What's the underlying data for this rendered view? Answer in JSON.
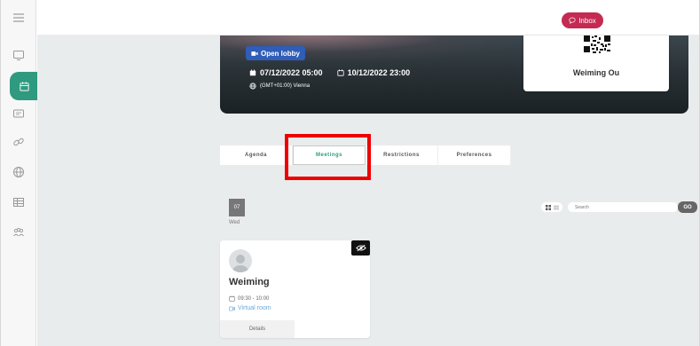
{
  "sidebar": {
    "items": [
      {
        "icon": "menu-icon"
      },
      {
        "icon": "monitor-icon"
      },
      {
        "icon": "calendar-icon",
        "active": true
      },
      {
        "icon": "contact-card-icon"
      },
      {
        "icon": "link-icon"
      },
      {
        "icon": "globe-icon"
      },
      {
        "icon": "table-icon"
      },
      {
        "icon": "group-icon"
      }
    ],
    "accent": "#2f9a7f"
  },
  "header": {
    "inbox_label": "Inbox",
    "inbox_color": "#c42a52"
  },
  "event": {
    "open_lobby_label": "Open lobby",
    "start": "07/12/2022 05:00",
    "end": "10/12/2022 23:00",
    "timezone": "(GMT+01:00) Vienna"
  },
  "user": {
    "name": "Weiming Ou"
  },
  "tabs": [
    {
      "label": "Agenda"
    },
    {
      "label": "Meetings",
      "active": true
    },
    {
      "label": "Restrictions"
    },
    {
      "label": "Preferences"
    }
  ],
  "day": {
    "number": "07",
    "name": "Wed"
  },
  "search": {
    "placeholder": "Search",
    "go_label": "GO"
  },
  "meeting": {
    "name": "Weiming",
    "time": "09:30 - 10:00",
    "room": "Virtual room",
    "details_label": "Details"
  }
}
